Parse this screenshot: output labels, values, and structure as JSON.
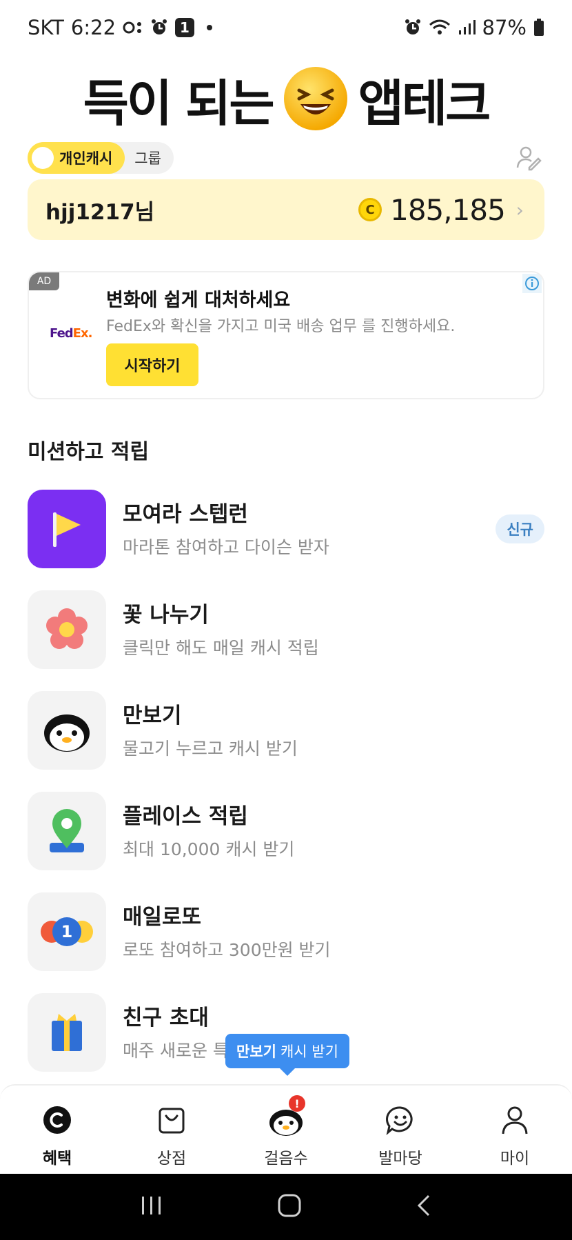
{
  "status_bar": {
    "carrier": "SKT",
    "time": "6:22",
    "notification_count": "1",
    "battery_percent": "87%"
  },
  "hero": {
    "title_left": "득이 되는",
    "title_right": "앱테크"
  },
  "toggle": {
    "personal_label": "개인캐시",
    "group_label": "그룹"
  },
  "user": {
    "name": "hjj1217님",
    "coin_symbol": "C",
    "cash": "185,185",
    "chevron": "›"
  },
  "ad": {
    "badge": "AD",
    "logo_fed": "Fed",
    "logo_ex": "Ex.",
    "title": "변화에 쉽게 대처하세요",
    "description": "FedEx와 확신을 가지고 미국 배송 업무 를 진행하세요.",
    "button": "시작하기"
  },
  "missions": {
    "section_title": "미션하고 적립",
    "items": [
      {
        "title": "모여라 스텝런",
        "subtitle": "마라톤 참여하고 다이슨 받자",
        "badge": "신규",
        "icon": "flag-icon"
      },
      {
        "title": "꽃 나누기",
        "subtitle": "클릭만 해도 매일 캐시 적립",
        "icon": "flower-icon"
      },
      {
        "title": "만보기",
        "subtitle": "물고기 누르고 캐시 받기",
        "icon": "penguin-icon"
      },
      {
        "title": "플레이스 적립",
        "subtitle": "최대 10,000 캐시 받기",
        "icon": "location-pin-icon"
      },
      {
        "title": "매일로또",
        "subtitle": "로또 참여하고 300만원 받기",
        "lotto_number": "1",
        "icon": "lotto-balls-icon"
      },
      {
        "title": "친구 초대",
        "subtitle": "매주 새로운 특",
        "icon": "gift-icon"
      }
    ]
  },
  "tooltip": {
    "bold": "만보기",
    "rest": "캐시 받기"
  },
  "bottom_nav": {
    "benefits": "혜택",
    "shop": "상점",
    "steps": "걸음수",
    "playground": "발마당",
    "my": "마이",
    "steps_alert": "!"
  },
  "colors": {
    "brand_yellow": "#ffe14d",
    "card_yellow": "#fff6cc",
    "tooltip_blue": "#3d8ef0",
    "badge_blue": "#3a7fc1",
    "flag_purple": "#7b2ff2"
  }
}
